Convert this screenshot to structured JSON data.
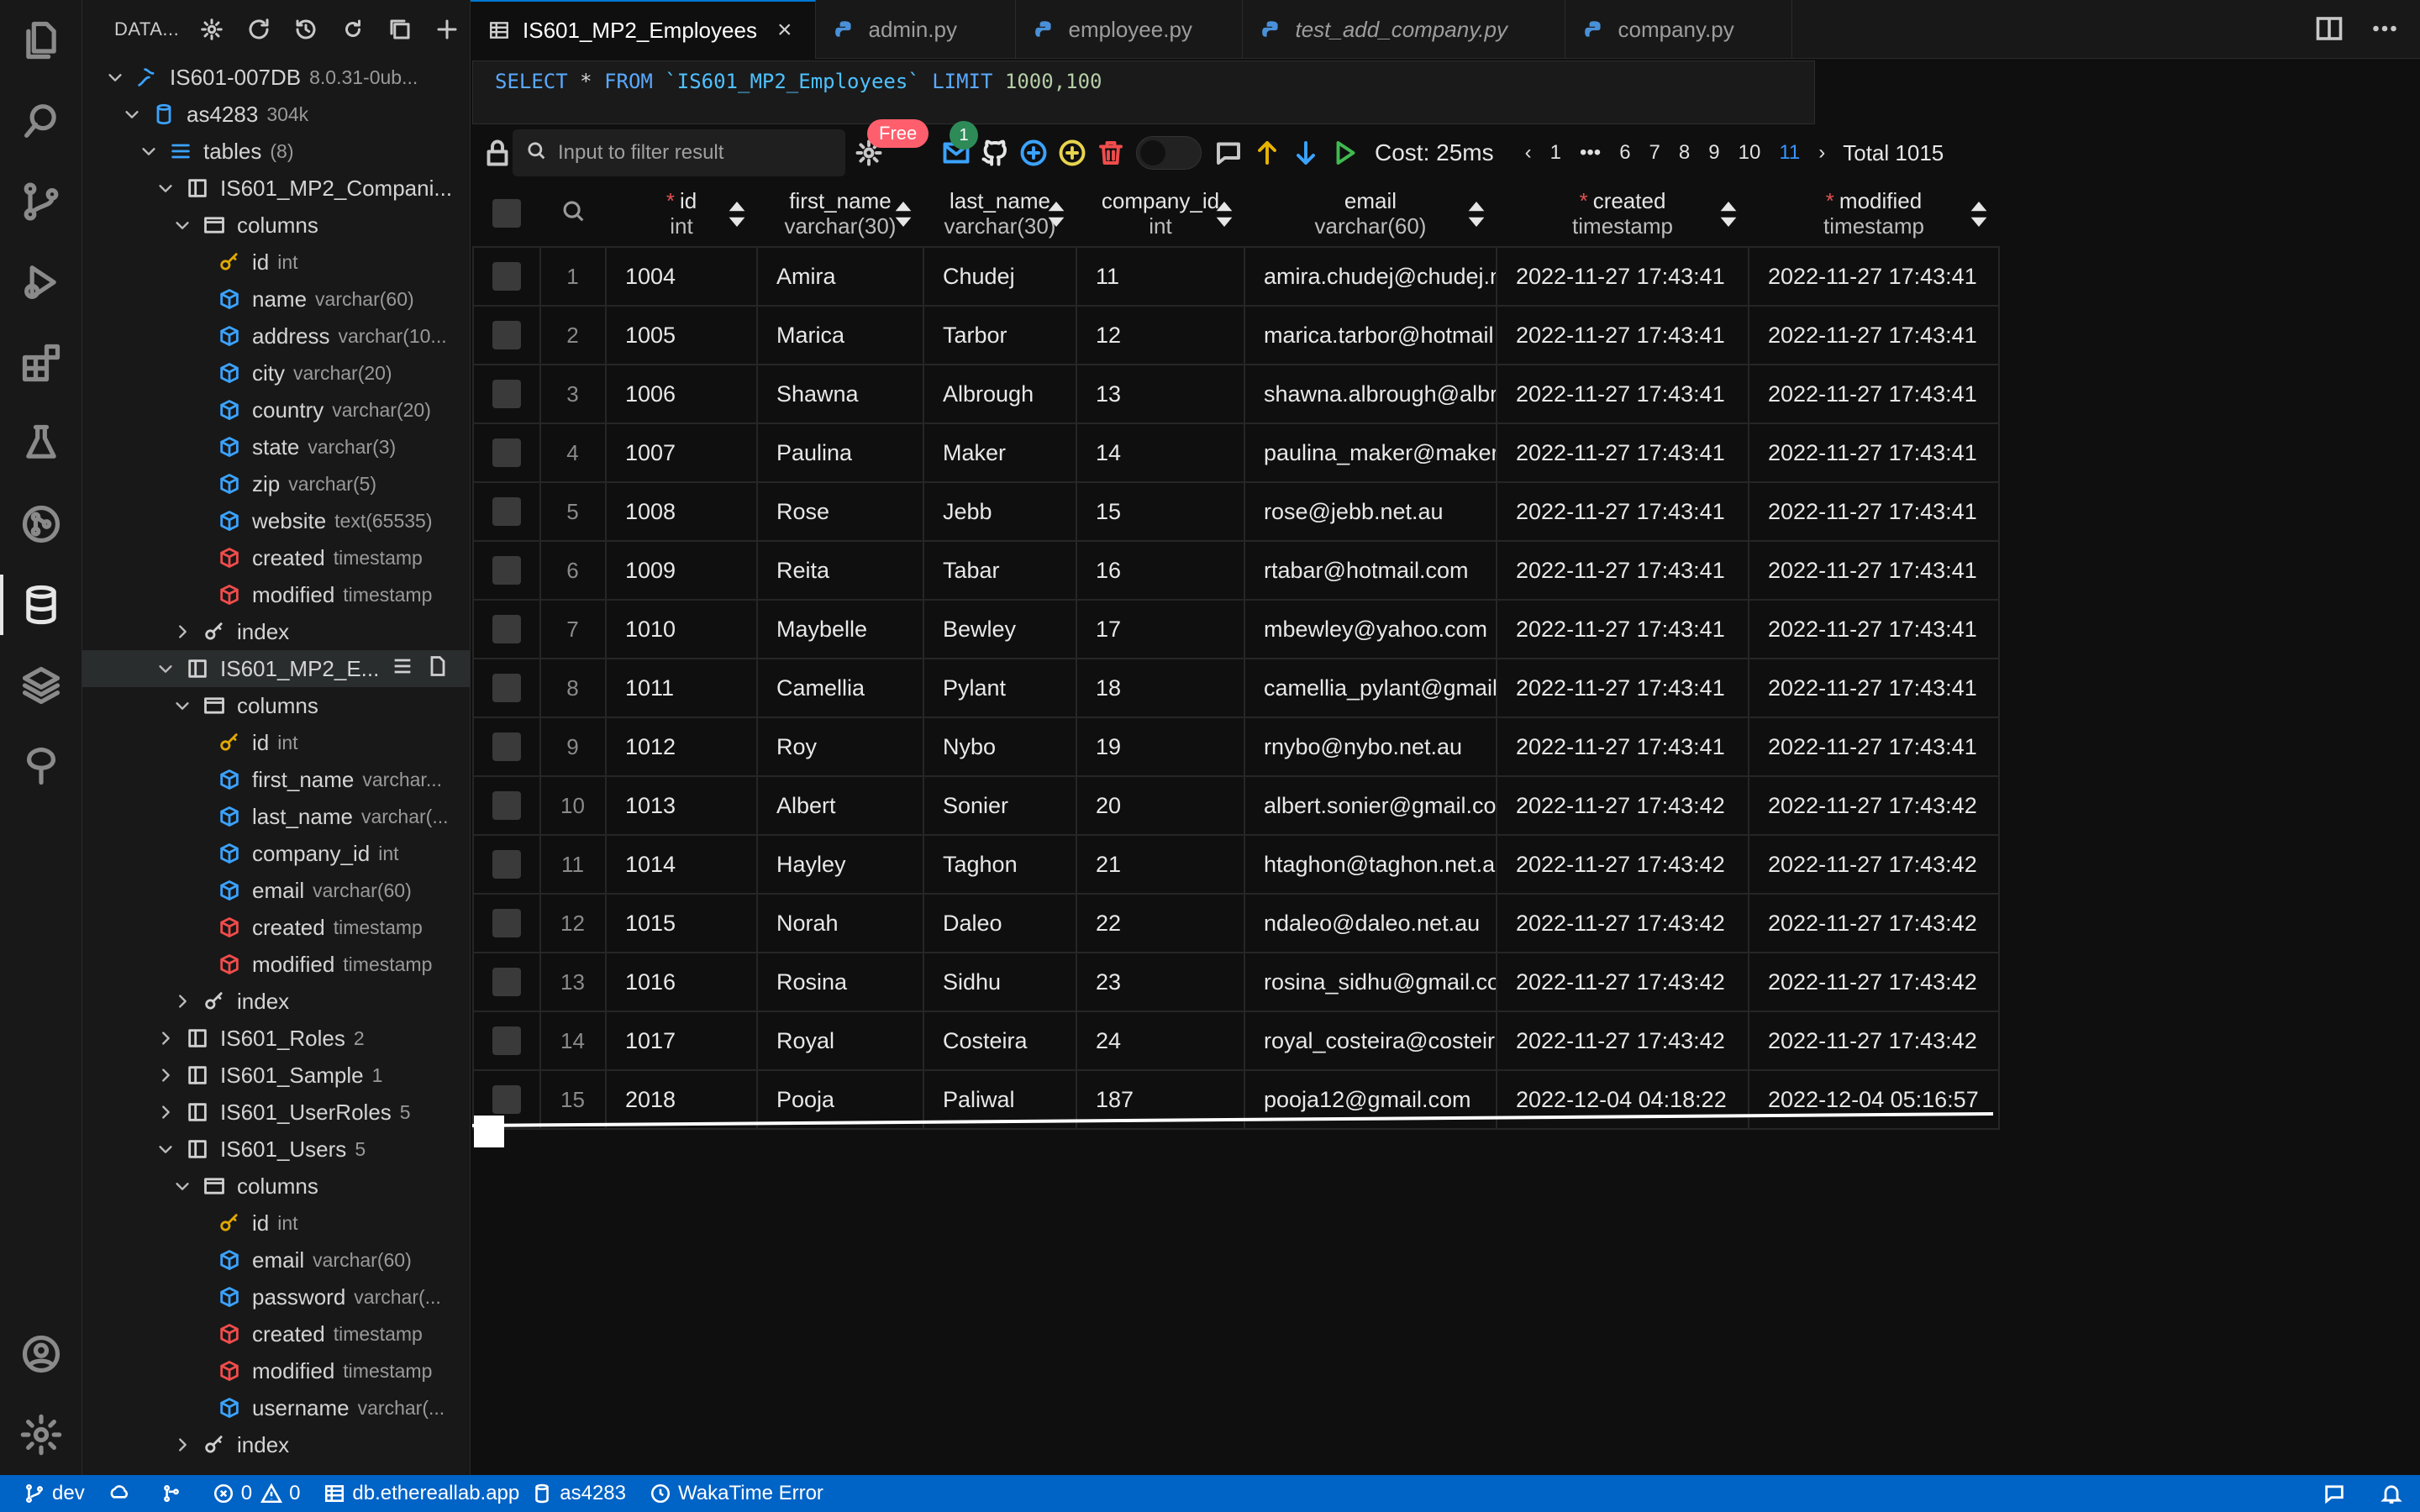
{
  "activity_bar": {
    "items": [
      "explorer-icon",
      "search-icon",
      "source-control-icon",
      "run-debug-icon",
      "extensions-icon",
      "testing-icon",
      "git-graph-icon",
      "database-icon",
      "layers-icon",
      "tree-icon"
    ],
    "bottom": [
      "account-icon",
      "settings-gear-icon"
    ]
  },
  "sidebar": {
    "title": "DATA...",
    "connection": {
      "name": "IS601-007DB",
      "meta": "8.0.31-0ub..."
    },
    "database": {
      "name": "as4283",
      "meta": "304k"
    },
    "tables_group": {
      "name": "tables",
      "meta": "(8)"
    },
    "columns_label": "columns",
    "index_label": "index",
    "companies": {
      "name": "IS601_MP2_Compani...",
      "columns": [
        {
          "name": "id",
          "type": "int"
        },
        {
          "name": "name",
          "type": "varchar(60)"
        },
        {
          "name": "address",
          "type": "varchar(10..."
        },
        {
          "name": "city",
          "type": "varchar(20)"
        },
        {
          "name": "country",
          "type": "varchar(20)"
        },
        {
          "name": "state",
          "type": "varchar(3)"
        },
        {
          "name": "zip",
          "type": "varchar(5)"
        },
        {
          "name": "website",
          "type": "text(65535)"
        },
        {
          "name": "created",
          "type": "timestamp"
        },
        {
          "name": "modified",
          "type": "timestamp"
        }
      ]
    },
    "employees": {
      "name": "IS601_MP2_E...",
      "columns": [
        {
          "name": "id",
          "type": "int"
        },
        {
          "name": "first_name",
          "type": "varchar..."
        },
        {
          "name": "last_name",
          "type": "varchar(..."
        },
        {
          "name": "company_id",
          "type": "int"
        },
        {
          "name": "email",
          "type": "varchar(60)"
        },
        {
          "name": "created",
          "type": "timestamp"
        },
        {
          "name": "modified",
          "type": "timestamp"
        }
      ]
    },
    "other_tables": [
      {
        "name": "IS601_Roles",
        "count": "2"
      },
      {
        "name": "IS601_Sample",
        "count": "1"
      },
      {
        "name": "IS601_UserRoles",
        "count": "5"
      }
    ],
    "users": {
      "name": "IS601_Users",
      "count": "5",
      "columns": [
        {
          "name": "id",
          "type": "int"
        },
        {
          "name": "email",
          "type": "varchar(60)"
        },
        {
          "name": "password",
          "type": "varchar(..."
        },
        {
          "name": "created",
          "type": "timestamp"
        },
        {
          "name": "modified",
          "type": "timestamp"
        },
        {
          "name": "username",
          "type": "varchar(..."
        }
      ]
    }
  },
  "tabs": [
    {
      "label": "IS601_MP2_Employees",
      "active": true
    },
    {
      "label": "admin.py"
    },
    {
      "label": "employee.py"
    },
    {
      "label": "test_add_company.py"
    },
    {
      "label": "company.py"
    }
  ],
  "query": {
    "select": "SELECT",
    "star": " * ",
    "from": "FROM",
    "table": " `IS601_MP2_Employees` ",
    "limit": "LIMIT",
    "limit_values": " 1000,100"
  },
  "toolbar": {
    "filter_placeholder": "Input to filter result",
    "free_badge": "Free",
    "notif_count": "1",
    "cost": "Cost: 25ms",
    "pages": [
      "1",
      "•••",
      "6",
      "7",
      "8",
      "9",
      "10",
      "11"
    ],
    "current_page": "11",
    "total": "Total 1015"
  },
  "grid": {
    "columns": [
      {
        "name": "id",
        "type": "int",
        "required": true
      },
      {
        "name": "first_name",
        "type": "varchar(30)"
      },
      {
        "name": "last_name",
        "type": "varchar(30)"
      },
      {
        "name": "company_id",
        "type": "int"
      },
      {
        "name": "email",
        "type": "varchar(60)"
      },
      {
        "name": "created",
        "type": "timestamp",
        "required": true
      },
      {
        "name": "modified",
        "type": "timestamp",
        "required": true
      }
    ],
    "rows": [
      [
        "1",
        "1004",
        "Amira",
        "Chudej",
        "11",
        "amira.chudej@chudej.n",
        "2022-11-27 17:43:41",
        "2022-11-27 17:43:41"
      ],
      [
        "2",
        "1005",
        "Marica",
        "Tarbor",
        "12",
        "marica.tarbor@hotmail",
        "2022-11-27 17:43:41",
        "2022-11-27 17:43:41"
      ],
      [
        "3",
        "1006",
        "Shawna",
        "Albrough",
        "13",
        "shawna.albrough@albr",
        "2022-11-27 17:43:41",
        "2022-11-27 17:43:41"
      ],
      [
        "4",
        "1007",
        "Paulina",
        "Maker",
        "14",
        "paulina_maker@maker.",
        "2022-11-27 17:43:41",
        "2022-11-27 17:43:41"
      ],
      [
        "5",
        "1008",
        "Rose",
        "Jebb",
        "15",
        "rose@jebb.net.au",
        "2022-11-27 17:43:41",
        "2022-11-27 17:43:41"
      ],
      [
        "6",
        "1009",
        "Reita",
        "Tabar",
        "16",
        "rtabar@hotmail.com",
        "2022-11-27 17:43:41",
        "2022-11-27 17:43:41"
      ],
      [
        "7",
        "1010",
        "Maybelle",
        "Bewley",
        "17",
        "mbewley@yahoo.com",
        "2022-11-27 17:43:41",
        "2022-11-27 17:43:41"
      ],
      [
        "8",
        "1011",
        "Camellia",
        "Pylant",
        "18",
        "camellia_pylant@gmail",
        "2022-11-27 17:43:41",
        "2022-11-27 17:43:41"
      ],
      [
        "9",
        "1012",
        "Roy",
        "Nybo",
        "19",
        "rnybo@nybo.net.au",
        "2022-11-27 17:43:41",
        "2022-11-27 17:43:41"
      ],
      [
        "10",
        "1013",
        "Albert",
        "Sonier",
        "20",
        "albert.sonier@gmail.co",
        "2022-11-27 17:43:42",
        "2022-11-27 17:43:42"
      ],
      [
        "11",
        "1014",
        "Hayley",
        "Taghon",
        "21",
        "htaghon@taghon.net.a",
        "2022-11-27 17:43:42",
        "2022-11-27 17:43:42"
      ],
      [
        "12",
        "1015",
        "Norah",
        "Daleo",
        "22",
        "ndaleo@daleo.net.au",
        "2022-11-27 17:43:42",
        "2022-11-27 17:43:42"
      ],
      [
        "13",
        "1016",
        "Rosina",
        "Sidhu",
        "23",
        "rosina_sidhu@gmail.co",
        "2022-11-27 17:43:42",
        "2022-11-27 17:43:42"
      ],
      [
        "14",
        "1017",
        "Royal",
        "Costeira",
        "24",
        "royal_costeira@costeir",
        "2022-11-27 17:43:42",
        "2022-11-27 17:43:42"
      ],
      [
        "15",
        "2018",
        "Pooja",
        "Paliwal",
        "187",
        "pooja12@gmail.com",
        "2022-12-04 04:18:22",
        "2022-12-04 05:16:57"
      ]
    ]
  },
  "statusbar": {
    "branch": "dev",
    "errors": "0",
    "warnings": "0",
    "host": "db.ethereallab.app",
    "database": "as4283",
    "wakatime": "WakaTime Error"
  },
  "colors": {
    "accent": "#0078d4",
    "statusbar": "#0063c6",
    "key_icon": "#e0a800",
    "column_icon": "#3ba3ff",
    "timestamp_icon": "#f14c4c",
    "required_mark": "#e05252"
  }
}
